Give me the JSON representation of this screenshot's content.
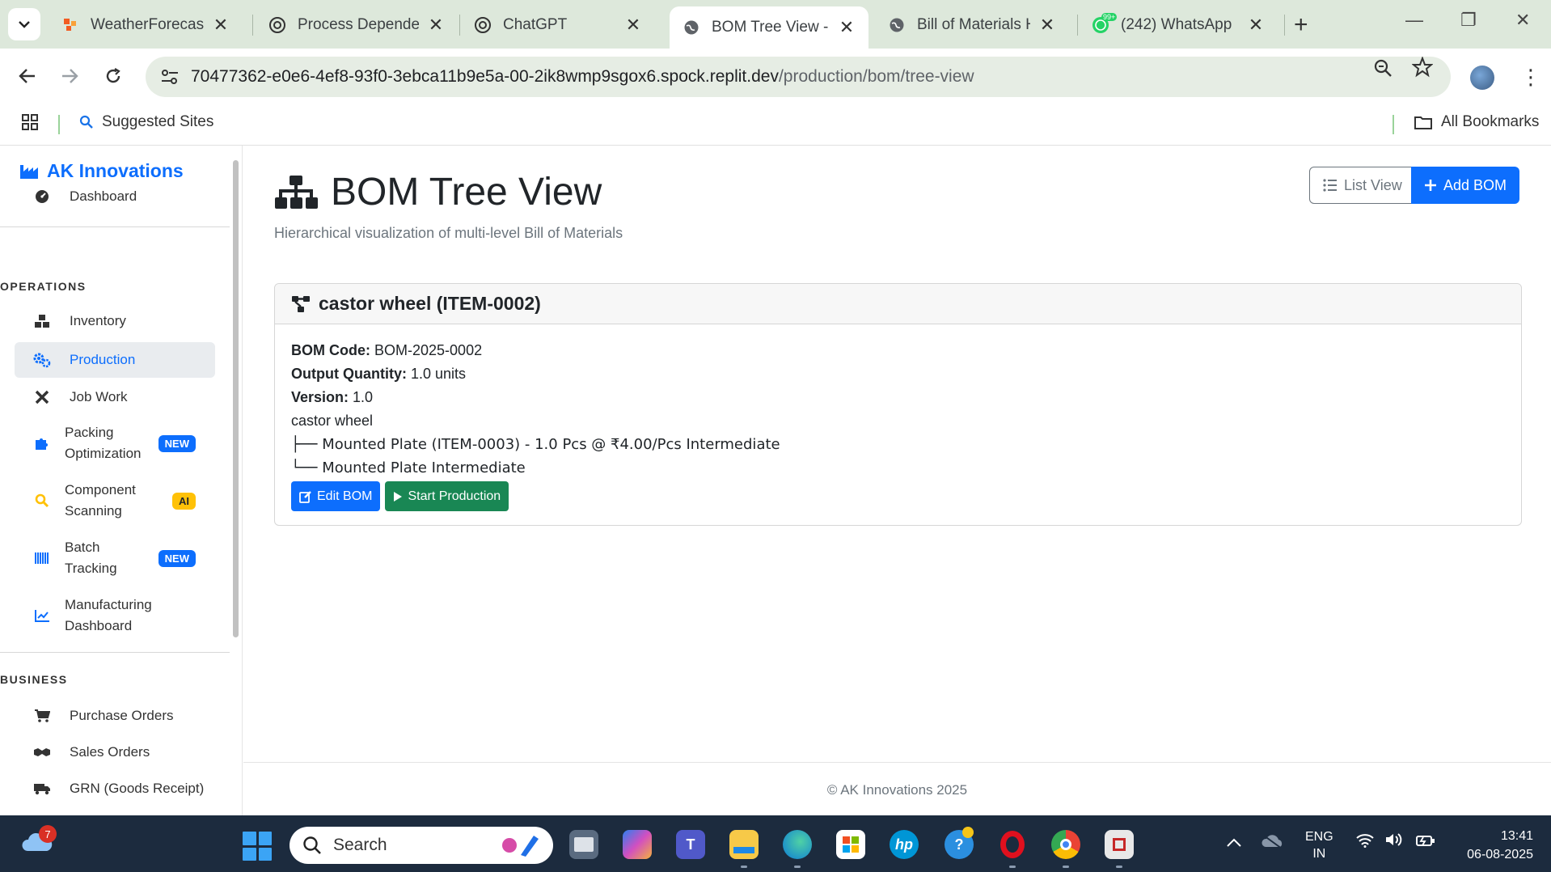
{
  "browser": {
    "tabs": [
      {
        "title": "WeatherForecast -",
        "icon": "weatherforecast-favicon",
        "active": false
      },
      {
        "title": "Process Dependen",
        "icon": "chatgpt-favicon",
        "active": false
      },
      {
        "title": "ChatGPT",
        "icon": "chatgpt-favicon",
        "active": false
      },
      {
        "title": "BOM Tree View - F",
        "icon": "globe-favicon",
        "active": true
      },
      {
        "title": "Bill of Materials He",
        "icon": "globe-favicon",
        "active": false
      },
      {
        "title": "(242) WhatsApp",
        "icon": "whatsapp-favicon",
        "active": false
      }
    ],
    "url_host": "70477362-e0e6-4ef8-93f0-3ebca11b9e5a-00-2ik8wmp9sgox6.spock.replit.dev",
    "url_path": "/production/bom/tree-view",
    "bookmarks": {
      "suggested": "Suggested Sites",
      "all": "All Bookmarks"
    },
    "whatsapp_badge": "99+"
  },
  "sidebar": {
    "brand": "AK Innovations",
    "dashboard": "Dashboard",
    "sections": {
      "operations": "OPERATIONS",
      "business": "BUSINESS"
    },
    "items": {
      "inventory": "Inventory",
      "production": "Production",
      "job_work": "Job Work",
      "packing_1": "Packing",
      "packing_2": "Optimization",
      "component_1": "Component",
      "component_2": "Scanning",
      "batch_1": "Batch",
      "batch_2": "Tracking",
      "mfg_1": "Manufacturing",
      "mfg_2": "Dashboard",
      "purchase": "Purchase Orders",
      "sales": "Sales Orders",
      "grn": "GRN (Goods Receipt)"
    },
    "badges": {
      "new": "NEW",
      "ai": "AI"
    }
  },
  "main": {
    "title": "BOM Tree View",
    "subtitle": "Hierarchical visualization of multi-level Bill of Materials",
    "list_view": "List View",
    "add_bom": "Add BOM",
    "card": {
      "header": "castor wheel (ITEM-0002)",
      "bom_code_label": "BOM Code:",
      "bom_code": "BOM-2025-0002",
      "output_label": "Output Quantity:",
      "output": "1.0 units",
      "version_label": "Version:",
      "version": "1.0",
      "root": "castor wheel",
      "tree_line_1": "├── Mounted Plate (ITEM-0003) - 1.0 Pcs @ ₹4.00/Pcs Intermediate",
      "tree_line_2": "└── Mounted Plate Intermediate",
      "edit": "Edit BOM",
      "start": "Start Production"
    },
    "footer": "© AK Innovations 2025"
  },
  "taskbar": {
    "search": "Search",
    "weather_badge": "7",
    "lang_1": "ENG",
    "lang_2": "IN",
    "time": "13:41",
    "date": "06-08-2025"
  },
  "colors": {
    "primary": "#0d6efd",
    "success": "#198754",
    "warning": "#ffc107",
    "chrome": "#dde8db"
  }
}
